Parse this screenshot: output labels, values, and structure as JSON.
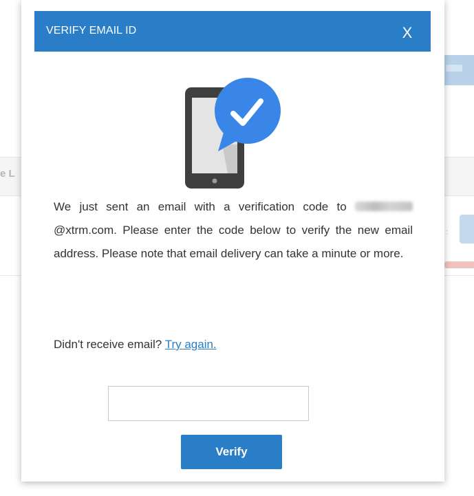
{
  "dialog": {
    "title": "VERIFY EMAIL ID",
    "close_label": "X"
  },
  "illustration": {
    "icon": "phone-with-checkmark-bubble-icon",
    "colors": {
      "phone_body": "#3f3f3f",
      "phone_screen": "#e4e4e4",
      "bubble": "#3a86e8",
      "check": "#ffffff"
    }
  },
  "message": {
    "line1": "We just sent an email with a verification code to",
    "email_domain": "@xtrm.com",
    "rest": ". Please enter the code below to verify the new email address. Please note that email delivery can take a minute or more."
  },
  "retry": {
    "prompt": "Didn't receive email?",
    "link_label": "Try again."
  },
  "code_input": {
    "value": "",
    "placeholder": ""
  },
  "verify_button": {
    "label": "Verify"
  },
  "background": {
    "partial_label": "e L"
  },
  "colors": {
    "accent": "#2a7ec7",
    "text": "#333333",
    "link": "#2a7ec7"
  }
}
